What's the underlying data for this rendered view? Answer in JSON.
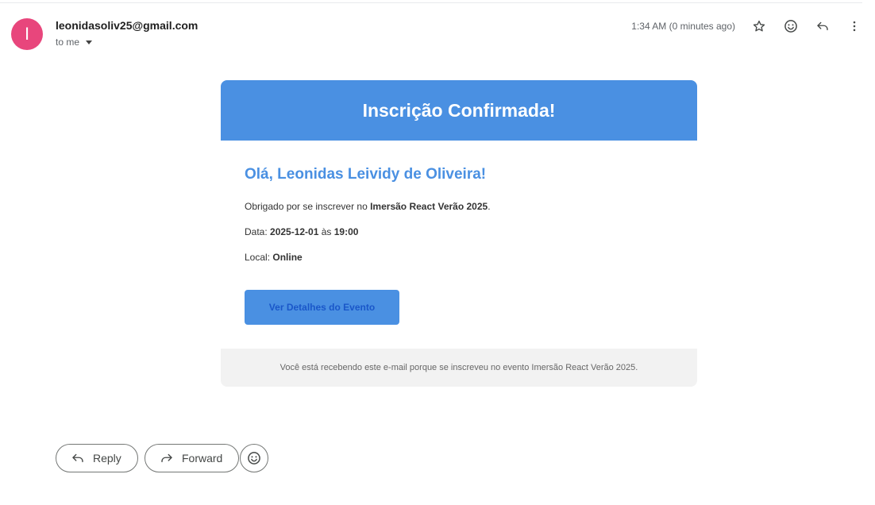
{
  "header": {
    "avatar_letter": "I",
    "sender": "leonidasoliv25@gmail.com",
    "recipient_label": "to me",
    "timestamp": "1:34 AM (0 minutes ago)",
    "icons": [
      "star-icon",
      "emoji-icon",
      "reply-icon",
      "more-vert-icon"
    ]
  },
  "email": {
    "title": "Inscrição Confirmada!",
    "greeting": "Olá, Leonidas Leividy de Oliveira!",
    "thanks_prefix": "Obrigado por se inscrever no ",
    "event_name": "Imersão React Verão 2025",
    "thanks_suffix": ".",
    "date_label": "Data: ",
    "date_value": "2025-12-01",
    "time_sep": " às ",
    "time_value": "19:00",
    "location_label": "Local: ",
    "location_value": "Online",
    "cta_label": "Ver Detalhes do Evento",
    "footer_text": "Você está recebendo este e-mail porque se inscreveu no evento Imersão React Verão 2025."
  },
  "actions": {
    "reply_label": "Reply",
    "forward_label": "Forward"
  },
  "colors": {
    "accent": "#4a90e2",
    "avatar": "#e8467c",
    "cta_text": "#1a57c9",
    "footer_bg": "#f2f2f2"
  }
}
